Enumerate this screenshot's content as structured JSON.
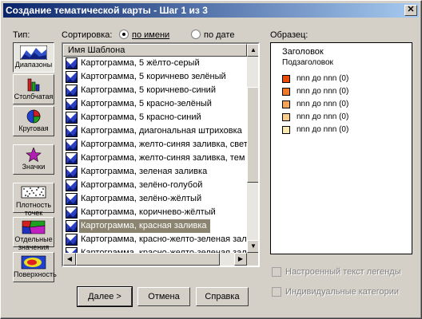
{
  "window": {
    "title": "Создание тематической карты - Шаг 1 из 3",
    "close_symbol": "✕"
  },
  "type_panel": {
    "label": "Тип:",
    "buttons": [
      {
        "label": "Диапазоны",
        "icon": "ranges-map-icon"
      },
      {
        "label": "Столбчатая",
        "icon": "bar-chart-icon"
      },
      {
        "label": "Круговая",
        "icon": "pie-chart-icon"
      },
      {
        "label": "Значки",
        "icon": "star-symbol-icon"
      },
      {
        "label": "Плотность точек",
        "icon": "dot-density-icon"
      },
      {
        "label": "Отдельные значения",
        "icon": "individual-values-icon"
      },
      {
        "label": "Поверхность",
        "icon": "surface-grid-icon"
      }
    ]
  },
  "sort": {
    "label": "Сортировка:",
    "by_name": "по имени",
    "by_date": "по дате",
    "selected": "by_name"
  },
  "template_list": {
    "header": "Имя Шаблона",
    "selected_index": 12,
    "items": [
      "Картограмма, 5 жёлто-серый",
      "Картограмма, 5 коричнево зелёный",
      "Картограмма, 5 коричнево-синий",
      "Картограмма, 5 красно-зелёный",
      "Картограмма, 5 красно-синий",
      "Картограмма, диагональная штриховка",
      "Картограмма, желто-синяя заливка, свет",
      "Картограмма, желто-синяя заливка, тем",
      "Картограмма, зеленая заливка",
      "Картограмма, зелёно-голубой",
      "Картограмма, зелёно-жёлтый",
      "Картограмма, коричнево-жёлтый",
      "Картограмма, красная заливка",
      "Картограмма, красно-желто-зеленая зал",
      "Картограмма, красно-желто-зеленая зал",
      "К"
    ]
  },
  "sample": {
    "label": "Образец:",
    "heading": "Заголовок",
    "subheading": "Подзаголовок",
    "legend": [
      {
        "text": "nnn до nnn  (0)",
        "color": "#e84c0a"
      },
      {
        "text": "nnn до nnn  (0)",
        "color": "#f07a2a"
      },
      {
        "text": "nnn до nnn  (0)",
        "color": "#f5a55a"
      },
      {
        "text": "nnn до nnn  (0)",
        "color": "#f8cc8a"
      },
      {
        "text": "nnn до nnn  (0)",
        "color": "#fbeab0"
      }
    ]
  },
  "options": {
    "custom_legend_text": "Настроенный текст легенды",
    "individual_categories": "Индивидуальные категории"
  },
  "buttons": {
    "next": "Далее >",
    "cancel": "Отмена",
    "help": "Справка"
  },
  "scroll_arrows": {
    "up": "▲",
    "down": "▼",
    "left": "◀",
    "right": "▶"
  }
}
